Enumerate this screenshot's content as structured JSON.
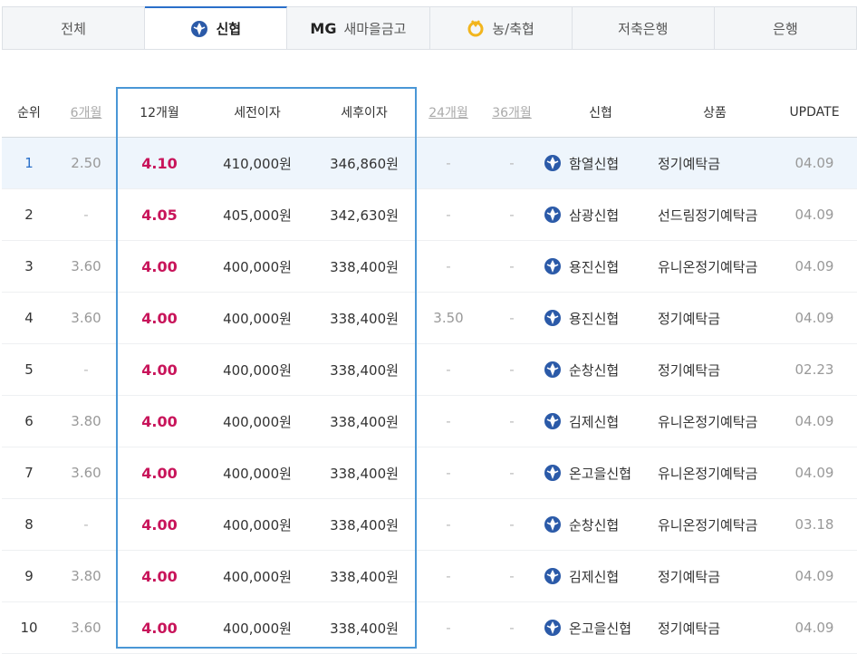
{
  "tabs": [
    {
      "label": "전체",
      "icon": "",
      "prefix": ""
    },
    {
      "label": "신협",
      "icon": "shinhyup-logo-icon",
      "prefix": ""
    },
    {
      "label": "새마을금고",
      "icon": "",
      "prefix": "MG"
    },
    {
      "label": "농/축협",
      "icon": "nonghyup-logo-icon",
      "prefix": ""
    },
    {
      "label": "저축은행",
      "icon": "",
      "prefix": ""
    },
    {
      "label": "은행",
      "icon": "",
      "prefix": ""
    }
  ],
  "active_tab": 1,
  "columns": [
    "순위",
    "6개월",
    "12개월",
    "세전이자",
    "세후이자",
    "24개월",
    "36개월",
    "신협",
    "상품",
    "UPDATE"
  ],
  "rows": [
    {
      "rank": "1",
      "m6": "2.50",
      "m12": "4.10",
      "pre": "410,000원",
      "post": "346,860원",
      "m24": "-",
      "m36": "-",
      "bank": "함열신협",
      "product": "정기예탁금",
      "update": "04.09"
    },
    {
      "rank": "2",
      "m6": "-",
      "m12": "4.05",
      "pre": "405,000원",
      "post": "342,630원",
      "m24": "-",
      "m36": "-",
      "bank": "삼광신협",
      "product": "선드림정기예탁금",
      "update": "04.09"
    },
    {
      "rank": "3",
      "m6": "3.60",
      "m12": "4.00",
      "pre": "400,000원",
      "post": "338,400원",
      "m24": "-",
      "m36": "-",
      "bank": "용진신협",
      "product": "유니온정기예탁금",
      "update": "04.09"
    },
    {
      "rank": "4",
      "m6": "3.60",
      "m12": "4.00",
      "pre": "400,000원",
      "post": "338,400원",
      "m24": "3.50",
      "m36": "-",
      "bank": "용진신협",
      "product": "정기예탁금",
      "update": "04.09"
    },
    {
      "rank": "5",
      "m6": "-",
      "m12": "4.00",
      "pre": "400,000원",
      "post": "338,400원",
      "m24": "-",
      "m36": "-",
      "bank": "순창신협",
      "product": "정기예탁금",
      "update": "02.23"
    },
    {
      "rank": "6",
      "m6": "3.80",
      "m12": "4.00",
      "pre": "400,000원",
      "post": "338,400원",
      "m24": "-",
      "m36": "-",
      "bank": "김제신협",
      "product": "유니온정기예탁금",
      "update": "04.09"
    },
    {
      "rank": "7",
      "m6": "3.60",
      "m12": "4.00",
      "pre": "400,000원",
      "post": "338,400원",
      "m24": "-",
      "m36": "-",
      "bank": "온고을신협",
      "product": "유니온정기예탁금",
      "update": "04.09"
    },
    {
      "rank": "8",
      "m6": "-",
      "m12": "4.00",
      "pre": "400,000원",
      "post": "338,400원",
      "m24": "-",
      "m36": "-",
      "bank": "순창신협",
      "product": "유니온정기예탁금",
      "update": "03.18"
    },
    {
      "rank": "9",
      "m6": "3.80",
      "m12": "4.00",
      "pre": "400,000원",
      "post": "338,400원",
      "m24": "-",
      "m36": "-",
      "bank": "김제신협",
      "product": "정기예탁금",
      "update": "04.09"
    },
    {
      "rank": "10",
      "m6": "3.60",
      "m12": "4.00",
      "pre": "400,000원",
      "post": "338,400원",
      "m24": "-",
      "m36": "-",
      "bank": "온고을신협",
      "product": "정기예탁금",
      "update": "04.09"
    }
  ],
  "colors": {
    "accent": "#c8145a",
    "highlight_border": "#4a97d6",
    "first_row_bg": "#eef5fc",
    "logo_blue": "#2b5aa8",
    "nh_yellow": "#f2b51d"
  }
}
